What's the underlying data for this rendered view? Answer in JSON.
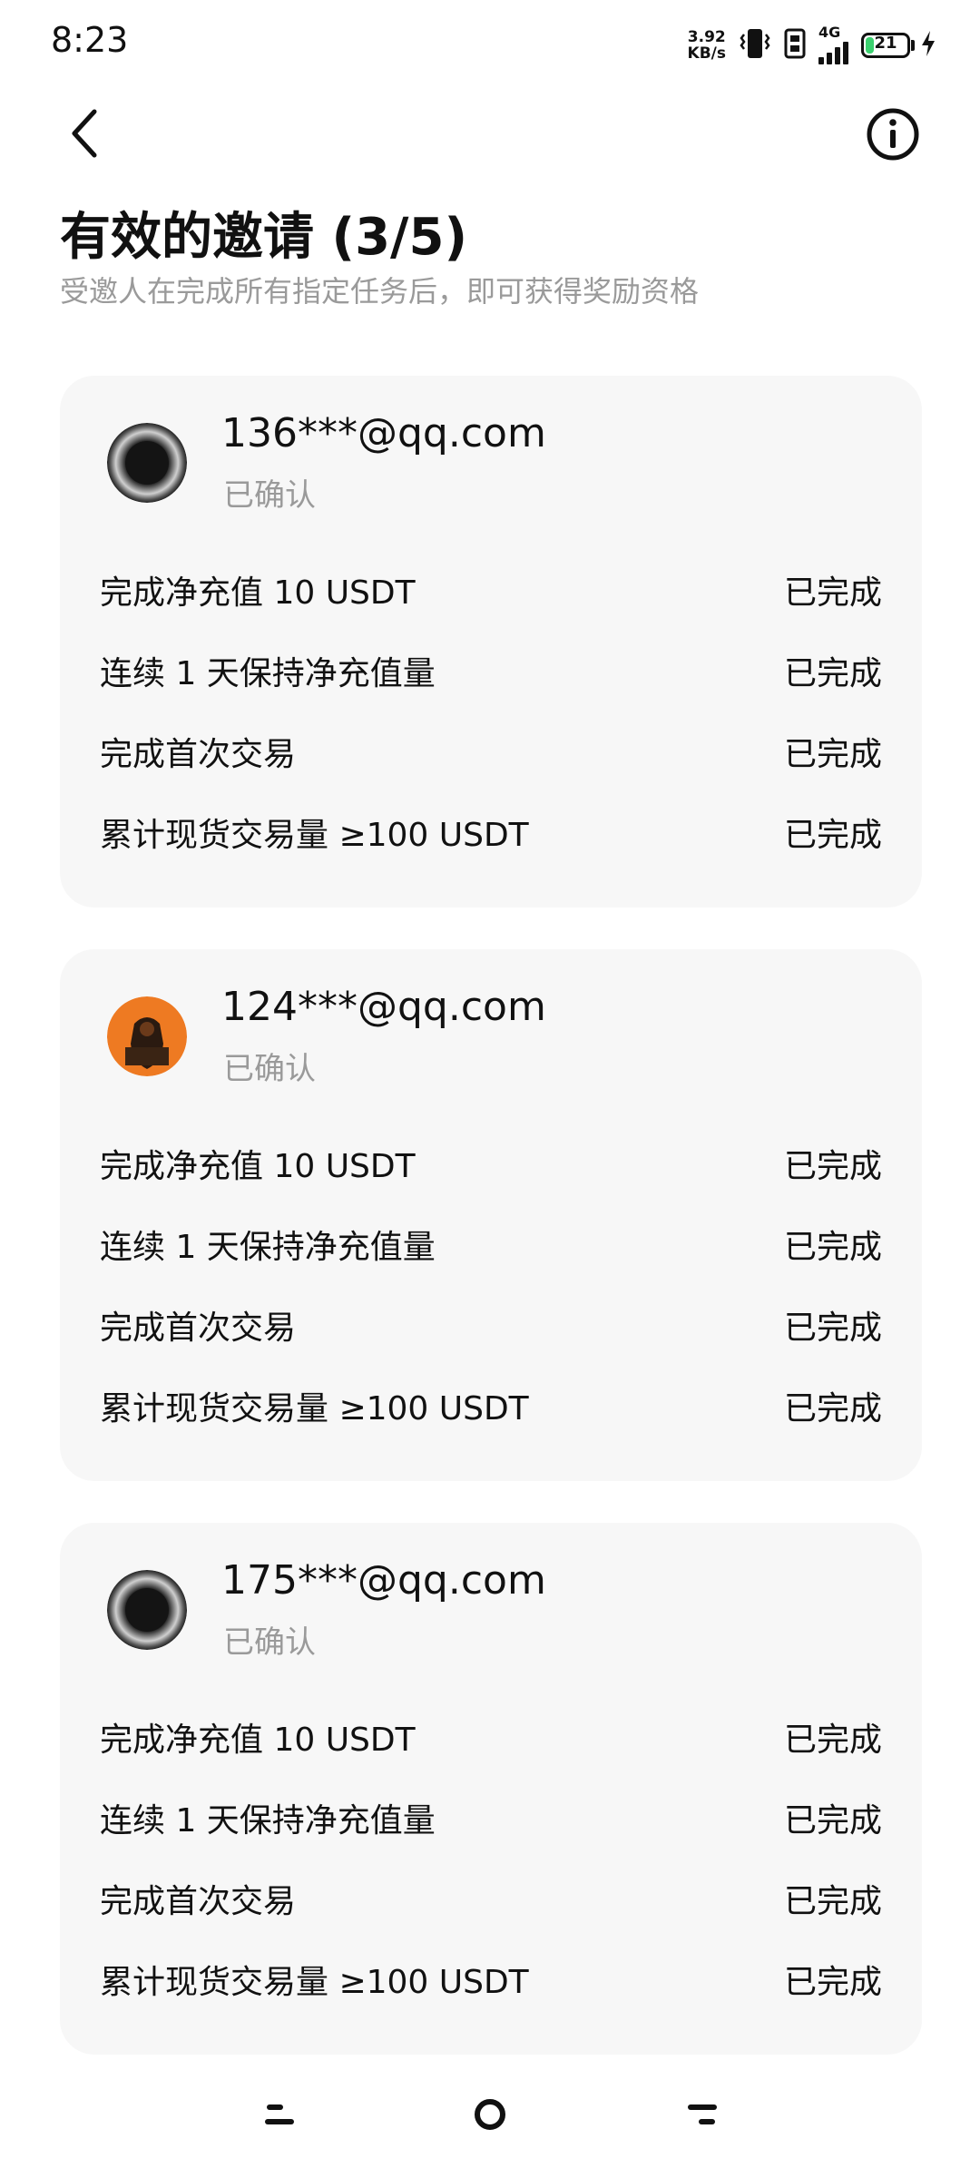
{
  "status_bar": {
    "time": "8:23",
    "net_speed_value": "3.92",
    "net_speed_unit": "KB/s",
    "network": "4G",
    "battery_level": "21",
    "battery_fraction": 0.21
  },
  "header": {
    "title": "有效的邀请 (3/5)",
    "subtitle": "受邀人在完成所有指定任务后，即可获得奖励资格"
  },
  "invitees": [
    {
      "email": "136***@qq.com",
      "status": "已确认",
      "avatar": "dark-sphere-avatar",
      "tasks": [
        {
          "name": "完成净充值 10 USDT",
          "status": "已完成"
        },
        {
          "name": "连续 1 天保持净充值量",
          "status": "已完成"
        },
        {
          "name": "完成首次交易",
          "status": "已完成"
        },
        {
          "name": "累计现货交易量 ≥100 USDT",
          "status": "已完成"
        }
      ]
    },
    {
      "email": "124***@qq.com",
      "status": "已确认",
      "avatar": "orange-figure-avatar",
      "tasks": [
        {
          "name": "完成净充值 10 USDT",
          "status": "已完成"
        },
        {
          "name": "连续 1 天保持净充值量",
          "status": "已完成"
        },
        {
          "name": "完成首次交易",
          "status": "已完成"
        },
        {
          "name": "累计现货交易量 ≥100 USDT",
          "status": "已完成"
        }
      ]
    },
    {
      "email": "175***@qq.com",
      "status": "已确认",
      "avatar": "dark-sphere-avatar",
      "tasks": [
        {
          "name": "完成净充值 10 USDT",
          "status": "已完成"
        },
        {
          "name": "连续 1 天保持净充值量",
          "status": "已完成"
        },
        {
          "name": "完成首次交易",
          "status": "已完成"
        },
        {
          "name": "累计现货交易量 ≥100 USDT",
          "status": "已完成"
        }
      ]
    }
  ],
  "colors": {
    "card_background": "#f7f7f7",
    "muted_text": "#9a9a9a",
    "battery_fill": "#3bd16f",
    "avatar_orange": "#ee7a22"
  }
}
